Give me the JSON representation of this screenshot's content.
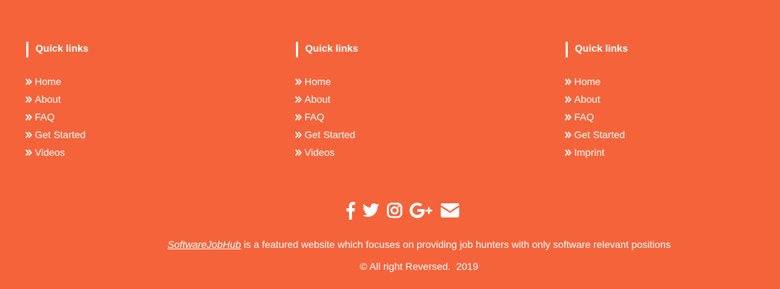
{
  "colors": {
    "background": "#F5633A",
    "text": "#FFFFFF"
  },
  "columns": [
    {
      "heading": "Quick links",
      "links": [
        "Home",
        "About",
        "FAQ",
        "Get Started",
        "Videos"
      ]
    },
    {
      "heading": "Quick links",
      "links": [
        "Home",
        "About",
        "FAQ",
        "Get Started",
        "Videos"
      ]
    },
    {
      "heading": "Quick links",
      "links": [
        "Home",
        "About",
        "FAQ",
        "Get Started",
        "Imprint"
      ]
    }
  ],
  "link_icon": "double-chevron-right-icon",
  "social": [
    "facebook-icon",
    "twitter-icon",
    "instagram-icon",
    "google-plus-icon",
    "envelope-icon"
  ],
  "tagline": {
    "brand": "SoftwareJobHub",
    "text": " is a featured website which focuses on providing job hunters with only software relevant positions"
  },
  "copyright": "© All right Reversed.  2019"
}
